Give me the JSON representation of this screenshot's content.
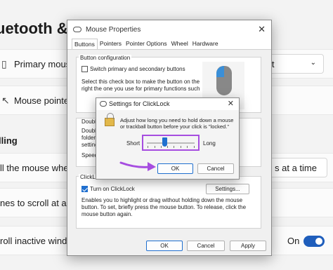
{
  "background": {
    "heading": "uetooth &",
    "rows": [
      {
        "label": "Primary mouse",
        "value": "eft"
      },
      {
        "label": "Mouse pointer s"
      },
      {
        "label": "ll the mouse wheel",
        "value": "s at a time"
      },
      {
        "label": "nes to scroll at a tim"
      },
      {
        "label": "roll inactive window",
        "value": "On"
      }
    ],
    "section": "lling"
  },
  "mouse_properties": {
    "title": "Mouse Properties",
    "close": "✕",
    "tabs": [
      "Buttons",
      "Pointers",
      "Pointer Options",
      "Wheel",
      "Hardware"
    ],
    "button_config": {
      "label": "Button configuration",
      "checkbox": "Switch primary and secondary buttons",
      "description": "Select this check box to make the button on the right the one you use for primary functions such as selecting and dragging."
    },
    "double_click": {
      "label": "Double",
      "lines": [
        "Double",
        "folder",
        "setting",
        "Speed"
      ]
    },
    "clicklock": {
      "label": "ClickLo",
      "checkbox": "Turn on ClickLock",
      "settings_button": "Settings...",
      "description": "Enables you to highlight or drag without holding down the mouse button. To set, briefly press the mouse button. To release, click the mouse button again."
    },
    "buttons": {
      "ok": "OK",
      "cancel": "Cancel",
      "apply": "Apply"
    }
  },
  "clicklock_dialog": {
    "title": "Settings for ClickLock",
    "close": "✕",
    "description": "Adjust how long you need to hold down a mouse or trackball button before your click is \"locked.\"",
    "short": "Short",
    "long": "Long",
    "slider_fraction": 0.38,
    "ok": "OK",
    "cancel": "Cancel"
  },
  "colors": {
    "accent": "#1f6fcf",
    "highlight": "#a64de0",
    "toggle": "#1f5ebc"
  }
}
